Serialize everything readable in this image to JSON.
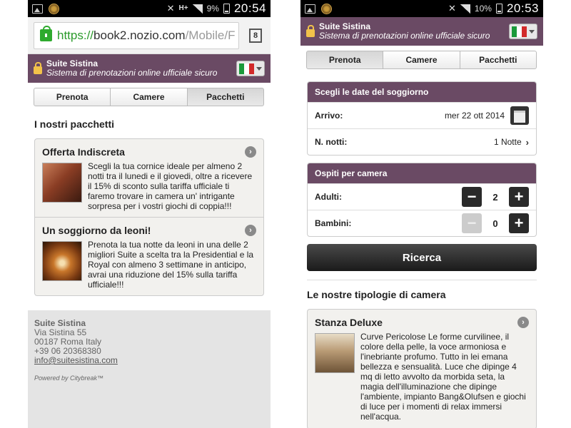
{
  "left": {
    "status": {
      "battery": "9%",
      "clock": "20:54",
      "network": "H+"
    },
    "urlbar": {
      "scheme": "https://",
      "host": "book2.nozio.com",
      "path": "/Mobile/F",
      "tab_count": "8"
    },
    "brand": {
      "name": "Suite Sistina",
      "tagline": "Sistema di prenotazioni online ufficiale sicuro"
    },
    "tabs": [
      "Prenota",
      "Camere",
      "Pacchetti"
    ],
    "active_tab": "Pacchetti",
    "section_title": "I nostri pacchetti",
    "packages": [
      {
        "title": "Offerta Indiscreta",
        "description": "Scegli la tua cornice ideale per almeno 2 notti tra il lunedi e il giovedi, oltre a ricevere il 15% di sconto sulla tariffa ufficiale ti faremo trovare in camera un' intrigante sorpresa per i vostri giochi di coppia!!!"
      },
      {
        "title": "Un soggiorno da leoni!",
        "description": "Prenota la tua notte da leoni in una delle 2 migliori Suite a scelta tra la Presidential e la Royal con almeno 3 settimane in anticipo, avrai una riduzione del 15% sulla tariffa ufficiale!!!"
      }
    ],
    "footer": {
      "name": "Suite Sistina",
      "address": "Via Sistina 55",
      "city": "00187 Roma Italy",
      "phone": "+39 06 20368380",
      "email": "info@suitesistina.com",
      "powered": "Powered by Citybreak™"
    }
  },
  "right": {
    "status": {
      "battery": "10%",
      "clock": "20:53"
    },
    "brand": {
      "name": "Suite Sistina",
      "tagline": "Sistema di prenotazioni online ufficiale sicuro"
    },
    "tabs": [
      "Prenota",
      "Camere",
      "Pacchetti"
    ],
    "active_tab": "Prenota",
    "dates": {
      "header": "Scegli le date del soggiorno",
      "arrival_label": "Arrivo:",
      "arrival_value": "mer 22 ott 2014",
      "nights_label": "N. notti:",
      "nights_value": "1 Notte"
    },
    "guests": {
      "header": "Ospiti per camera",
      "adults_label": "Adulti:",
      "adults_value": "2",
      "children_label": "Bambini:",
      "children_value": "0"
    },
    "search_label": "Ricerca",
    "rooms_title": "Le nostre tipologie di camera",
    "room": {
      "title": "Stanza Deluxe",
      "description": "Curve Pericolose Le forme curvilinee, il colore della pelle, la voce armoniosa e l'inebriante profumo. Tutto in lei emana bellezza e sensualità. Luce che dipinge 4 mq di letto avvolto da morbida seta, la magia dell'illuminazione che dipinge l'ambiente, impianto Bang&Olufsen e giochi di luce per i momenti di relax immersi nell'acqua."
    }
  },
  "colors": {
    "brand": "#6a4a64",
    "url_secure": "#2a9a2a",
    "footer_bg": "#e4e4e4"
  },
  "icons": [
    "image-icon",
    "app-icon",
    "mute-icon",
    "signal-icon",
    "battery-icon",
    "lock-icon",
    "flag-italy-icon",
    "chevron-right-icon",
    "calendar-icon",
    "minus-icon",
    "plus-icon"
  ]
}
